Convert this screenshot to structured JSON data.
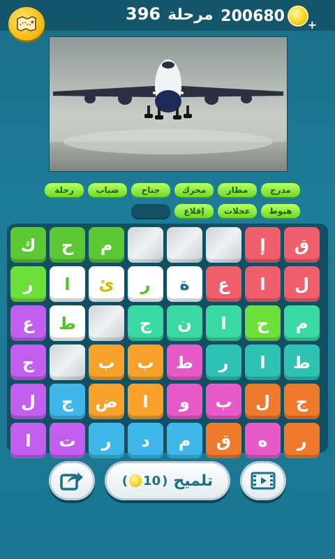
{
  "header": {
    "level_label": "مرحلة",
    "level_number": "396",
    "coins": "200680",
    "plus": "+"
  },
  "icons": {
    "map": "treasure-map-icon",
    "coin": "coin-icon",
    "share": "share-icon",
    "video": "video-icon"
  },
  "photo": {
    "subject": "airplane-taking-off"
  },
  "words": {
    "row1": [
      "مدرج",
      "مطار",
      "محرك",
      "جناح",
      "ضباب",
      "رحلة"
    ],
    "row2": [
      "هبوط",
      "عجلات",
      "إقلاع",
      ""
    ]
  },
  "grid": [
    [
      {
        "l": "ق",
        "c": "red"
      },
      {
        "l": "إ",
        "c": "red"
      },
      {
        "l": "",
        "c": "used"
      },
      {
        "l": "",
        "c": "used"
      },
      {
        "l": "",
        "c": "used"
      },
      {
        "l": "م",
        "c": "green"
      },
      {
        "l": "ح",
        "c": "green"
      },
      {
        "l": "ك",
        "c": "green"
      }
    ],
    [
      {
        "l": "ل",
        "c": "red"
      },
      {
        "l": "ا",
        "c": "red"
      },
      {
        "l": "ع",
        "c": "red"
      },
      {
        "l": "ة",
        "c": "white-dk"
      },
      {
        "l": "ر",
        "c": "white"
      },
      {
        "l": "ئ",
        "c": "white-lt"
      },
      {
        "l": "ا",
        "c": "white"
      },
      {
        "l": "ر",
        "c": "lime"
      }
    ],
    [
      {
        "l": "م",
        "c": "mint"
      },
      {
        "l": "ح",
        "c": "lime"
      },
      {
        "l": "ا",
        "c": "mint"
      },
      {
        "l": "ن",
        "c": "mint"
      },
      {
        "l": "ج",
        "c": "mint"
      },
      {
        "l": "",
        "c": "used"
      },
      {
        "l": "ط",
        "c": "white"
      },
      {
        "l": "ع",
        "c": "purple"
      }
    ],
    [
      {
        "l": "ط",
        "c": "teal"
      },
      {
        "l": "ا",
        "c": "teal"
      },
      {
        "l": "ر",
        "c": "teal"
      },
      {
        "l": "ط",
        "c": "pink"
      },
      {
        "l": "ب",
        "c": "orange"
      },
      {
        "l": "ب",
        "c": "orange"
      },
      {
        "l": "",
        "c": "used"
      },
      {
        "l": "ج",
        "c": "purple"
      }
    ],
    [
      {
        "l": "ج",
        "c": "deeporange"
      },
      {
        "l": "ل",
        "c": "deeporange"
      },
      {
        "l": "ب",
        "c": "pink"
      },
      {
        "l": "و",
        "c": "pink"
      },
      {
        "l": "ا",
        "c": "orange"
      },
      {
        "l": "ض",
        "c": "orange"
      },
      {
        "l": "ج",
        "c": "blue"
      },
      {
        "l": "ل",
        "c": "purple"
      }
    ],
    [
      {
        "l": "ر",
        "c": "deeporange"
      },
      {
        "l": "ه",
        "c": "pink"
      },
      {
        "l": "ق",
        "c": "deeporange"
      },
      {
        "l": "م",
        "c": "blue"
      },
      {
        "l": "د",
        "c": "blue"
      },
      {
        "l": "ر",
        "c": "blue"
      },
      {
        "l": "ت",
        "c": "purple"
      },
      {
        "l": "ا",
        "c": "purple"
      }
    ]
  ],
  "bottom": {
    "hint_label": "تلميح",
    "hint_cost": "10",
    "hint_open": "(",
    "hint_close": ")"
  }
}
